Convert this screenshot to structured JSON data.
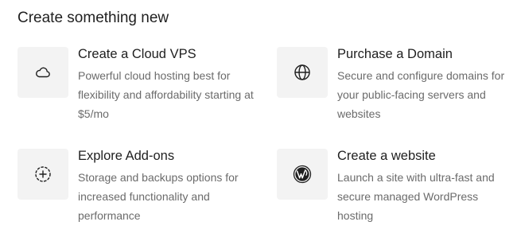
{
  "section": {
    "title": "Create something new"
  },
  "cards": [
    {
      "icon": "cloud-icon",
      "title": "Create a Cloud VPS",
      "description": "Powerful cloud hosting best for flexibility and affordability starting at $5/mo"
    },
    {
      "icon": "globe-icon",
      "title": "Purchase a Domain",
      "description": "Secure and configure domains for your public-facing servers and websites"
    },
    {
      "icon": "add-circle-icon",
      "title": "Explore Add-ons",
      "description": "Storage and backups options for increased functionality and performance"
    },
    {
      "icon": "wordpress-icon",
      "title": "Create a website",
      "description": "Launch a site with ultra-fast and secure managed WordPress hosting"
    }
  ],
  "colors": {
    "heading": "#1f1f1f",
    "muted_text": "#6b6b6b",
    "icon_tile": "#f3f3f3"
  }
}
